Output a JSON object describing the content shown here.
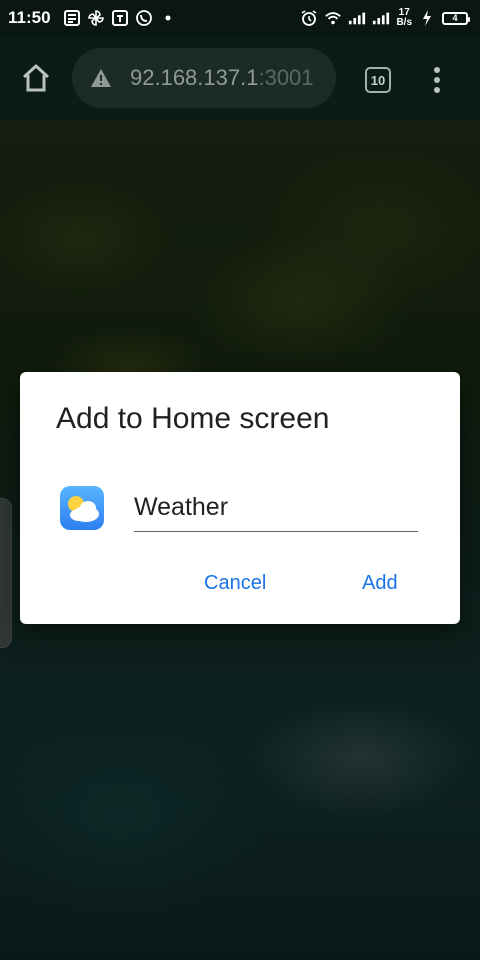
{
  "status_bar": {
    "time": "11:50",
    "speed_value": "17",
    "speed_unit": "B/s",
    "battery": "4"
  },
  "browser": {
    "url_host": "92.168.137.1",
    "url_port": ":3001",
    "tab_count": "10"
  },
  "dialog": {
    "title": "Add to Home screen",
    "app_name": "Weather",
    "cancel_label": "Cancel",
    "add_label": "Add"
  },
  "colors": {
    "accent": "#1a73e8",
    "toolbar": "#0b1b17"
  }
}
